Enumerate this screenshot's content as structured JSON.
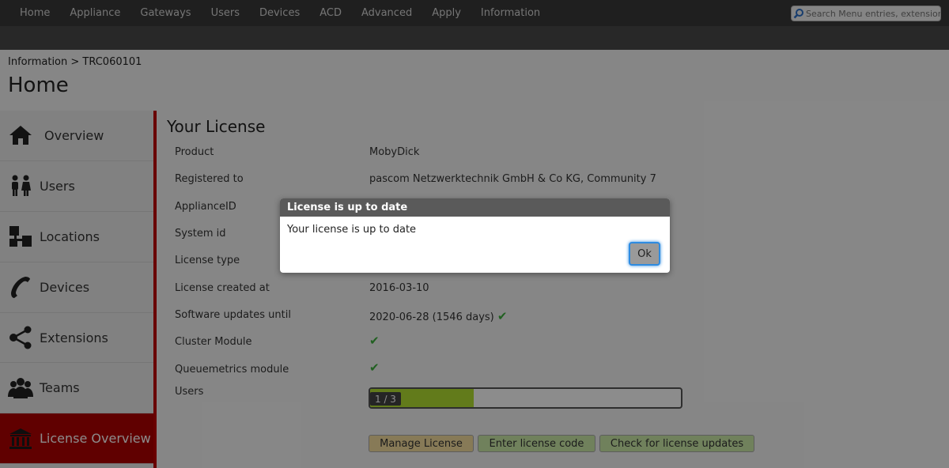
{
  "topnav": {
    "items": [
      "Home",
      "Appliance",
      "Gateways",
      "Users",
      "Devices",
      "ACD",
      "Advanced",
      "Apply",
      "Information"
    ],
    "search_placeholder": "Search Menu entries, extensions"
  },
  "breadcrumb": "Information > TRC060101",
  "page_title": "Home",
  "sidebar": {
    "items": [
      {
        "label": "Overview",
        "icon": "house-icon"
      },
      {
        "label": "Users",
        "icon": "users-icon"
      },
      {
        "label": "Locations",
        "icon": "locations-icon"
      },
      {
        "label": "Devices",
        "icon": "phone-icon"
      },
      {
        "label": "Extensions",
        "icon": "share-icon"
      },
      {
        "label": "Teams",
        "icon": "team-icon"
      },
      {
        "label": "License Overview",
        "icon": "bank-icon"
      }
    ],
    "active": "License Overview"
  },
  "license": {
    "title": "Your License",
    "rows": [
      {
        "label": "Product",
        "value": "MobyDick"
      },
      {
        "label": "Registered to",
        "value": "pascom Netzwerktechnik GmbH & Co KG, Community 7"
      },
      {
        "label": "ApplianceID",
        "value": ""
      },
      {
        "label": "System id",
        "value": ""
      },
      {
        "label": "License type",
        "value": ""
      },
      {
        "label": "License created at",
        "value": "2016-03-10"
      },
      {
        "label": "Software updates until",
        "value": "2020-06-28 (1546 days)"
      },
      {
        "label": "Cluster Module",
        "value": ""
      },
      {
        "label": "Queuemetrics module",
        "value": ""
      },
      {
        "label": "Users",
        "value": ""
      }
    ],
    "users_progress": {
      "text": "1 / 3",
      "used": 1,
      "total": 3
    },
    "buttons": {
      "manage": "Manage License",
      "enter_code": "Enter license code",
      "check_updates": "Check for license updates"
    }
  },
  "dialog": {
    "title": "License is up to date",
    "message": "Your license is up to date",
    "ok_label": "Ok"
  },
  "colors": {
    "accent_red": "#c00000",
    "check_green": "#3cb03c",
    "progress_fill": "#b2e032"
  }
}
